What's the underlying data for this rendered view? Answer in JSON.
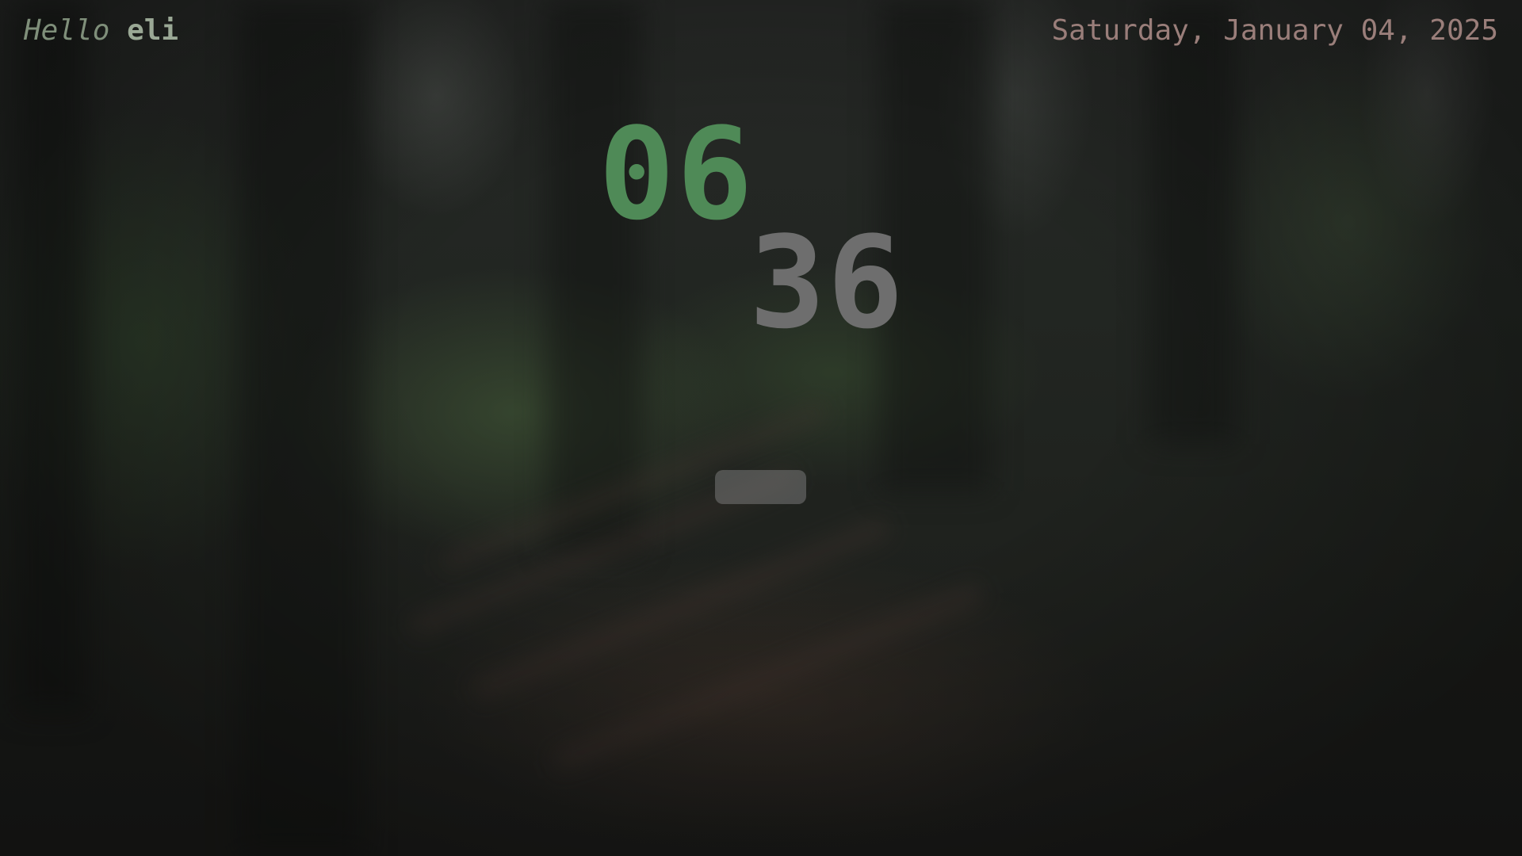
{
  "greeting": {
    "hello": "Hello",
    "user": "eli"
  },
  "date": "Saturday, January 04, 2025",
  "clock": {
    "hours": "06",
    "minutes": "36"
  },
  "search": {
    "value": "",
    "placeholder": ""
  },
  "colors": {
    "hours": "#4f8a57",
    "minutes": "#6e6e6e",
    "date": "#9a7e7a",
    "greeting": "#8a9a84",
    "search_bg": "#6a6a6a"
  }
}
